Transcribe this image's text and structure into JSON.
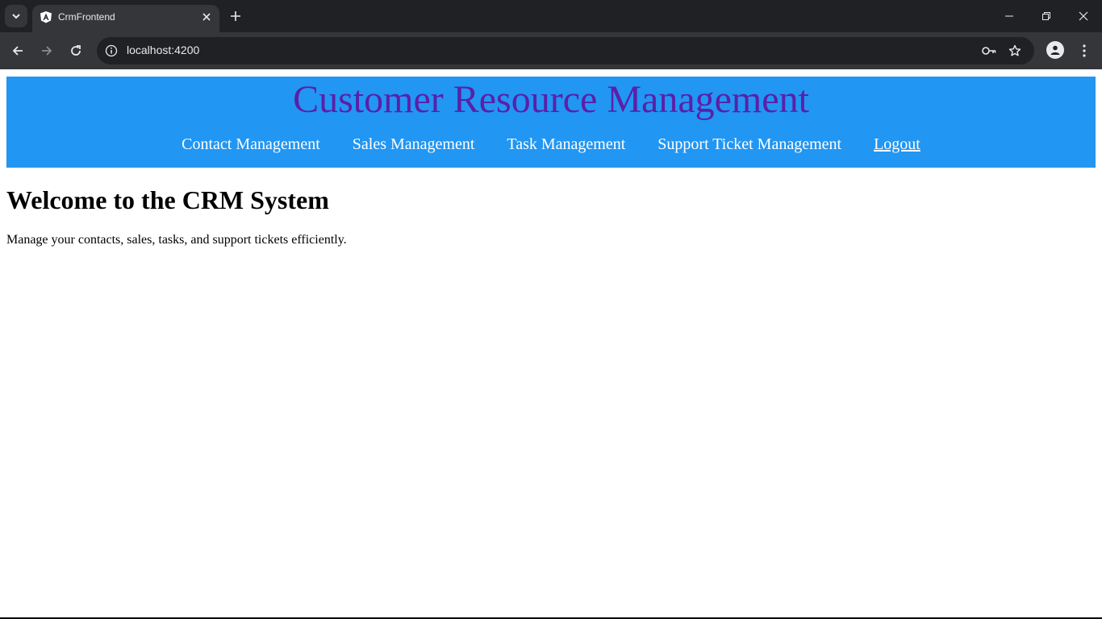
{
  "browser": {
    "tab": {
      "title": "CrmFrontend",
      "favicon": "angular-logo-icon"
    },
    "address_bar": {
      "url": "localhost:4200"
    },
    "icons": {
      "tab_search": "chevron-down-icon",
      "tab_close": "close-icon",
      "new_tab": "plus-icon",
      "back": "back-arrow-icon",
      "forward": "forward-arrow-icon",
      "reload": "reload-icon",
      "site_info": "info-icon",
      "passwords": "key-icon",
      "bookmark": "star-icon",
      "profile": "profile-icon",
      "menu": "kebab-menu-icon",
      "minimize": "minimize-icon",
      "restore": "restore-icon",
      "close_window": "close-icon"
    }
  },
  "page": {
    "header": {
      "title": "Customer Resource Management",
      "nav": [
        {
          "label": "Contact Management"
        },
        {
          "label": "Sales Management"
        },
        {
          "label": "Task Management"
        },
        {
          "label": "Support Ticket Management"
        },
        {
          "label": "Logout"
        }
      ]
    },
    "main": {
      "heading": "Welcome to the CRM System",
      "description": "Manage your contacts, sales, tasks, and support tickets efficiently."
    }
  },
  "colors": {
    "header_background": "#2196f3",
    "title_text": "#5b1fa8",
    "nav_text": "#ffffff",
    "browser_frame": "#202124",
    "browser_toolbar": "#35363a"
  }
}
